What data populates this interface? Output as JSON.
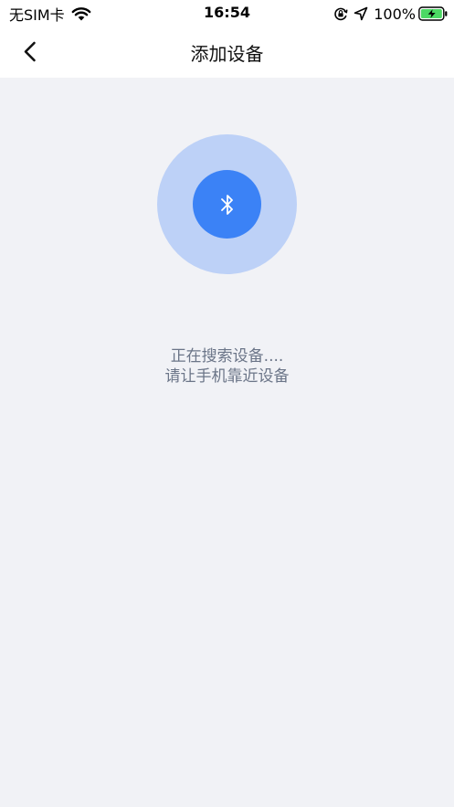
{
  "status_bar": {
    "carrier": "无SIM卡",
    "time": "16:54",
    "battery": "100%",
    "icons": [
      "wifi-icon",
      "orientation-lock-icon",
      "location-arrow-icon",
      "battery-charging-icon"
    ]
  },
  "nav": {
    "title": "添加设备",
    "back_icon": "chevron-left-icon"
  },
  "scan": {
    "icon": "bluetooth-icon",
    "status_text": "正在搜索设备....",
    "hint_text": "请让手机靠近设备"
  },
  "colors": {
    "background": "#F1F2F6",
    "accent": "#3B82F6",
    "ring": "#BDD1F7",
    "hint_text": "#6B7588",
    "battery_green": "#4CD964"
  }
}
